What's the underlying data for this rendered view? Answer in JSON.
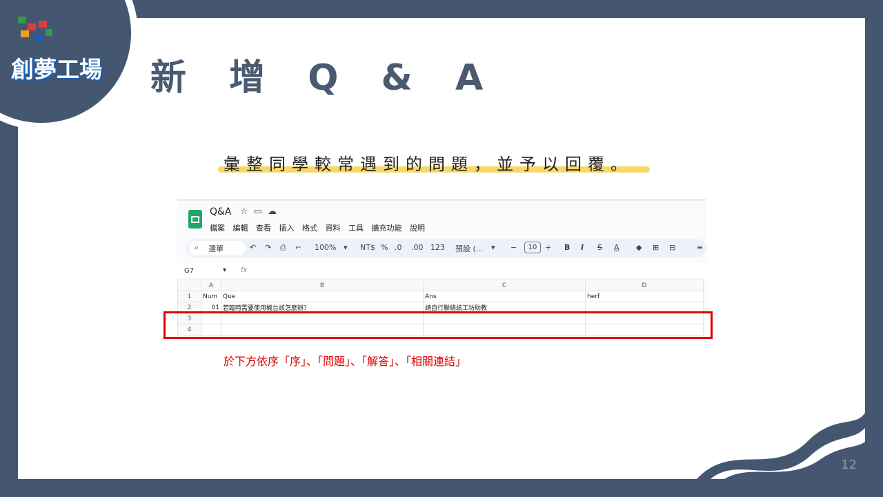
{
  "logo": {
    "text": "創夢工場"
  },
  "title": "新 增 Q & A",
  "subtitle": "彙整同學較常遇到的問題，並予以回覆。",
  "spreadsheet": {
    "doc_title": "Q&A",
    "menu": [
      "檔案",
      "編輯",
      "查看",
      "插入",
      "格式",
      "資料",
      "工具",
      "擴充功能",
      "說明"
    ],
    "search_placeholder": "選單",
    "zoom": "100%",
    "currency": "NT$",
    "percent": "%",
    "dec_less": ".0",
    "dec_more": ".00",
    "number_fmt": "123",
    "font": "預設 (...",
    "font_size": "10",
    "cell_ref": "G7",
    "fx": "fx",
    "columns": [
      "A",
      "B",
      "C",
      "D"
    ],
    "rows": [
      {
        "num": "1",
        "a": "Num",
        "b": "Que",
        "c": "Ans",
        "d": "herf"
      },
      {
        "num": "2",
        "a": "01",
        "b": "若臨時需要使用機台該怎麼辦？",
        "c": "請自行聯絡該工坊助教",
        "d": ""
      },
      {
        "num": "3",
        "a": "",
        "b": "",
        "c": "",
        "d": ""
      },
      {
        "num": "4",
        "a": "",
        "b": "",
        "c": "",
        "d": ""
      }
    ]
  },
  "note": "於下方依序「序」、「問題」、「解答」、「相關連結」",
  "page_number": "12",
  "colors": {
    "frame": "#455770",
    "title": "#4a5a70",
    "highlight": "#f6d86a",
    "annotation": "#e00000",
    "sheets_green": "#23a566"
  }
}
